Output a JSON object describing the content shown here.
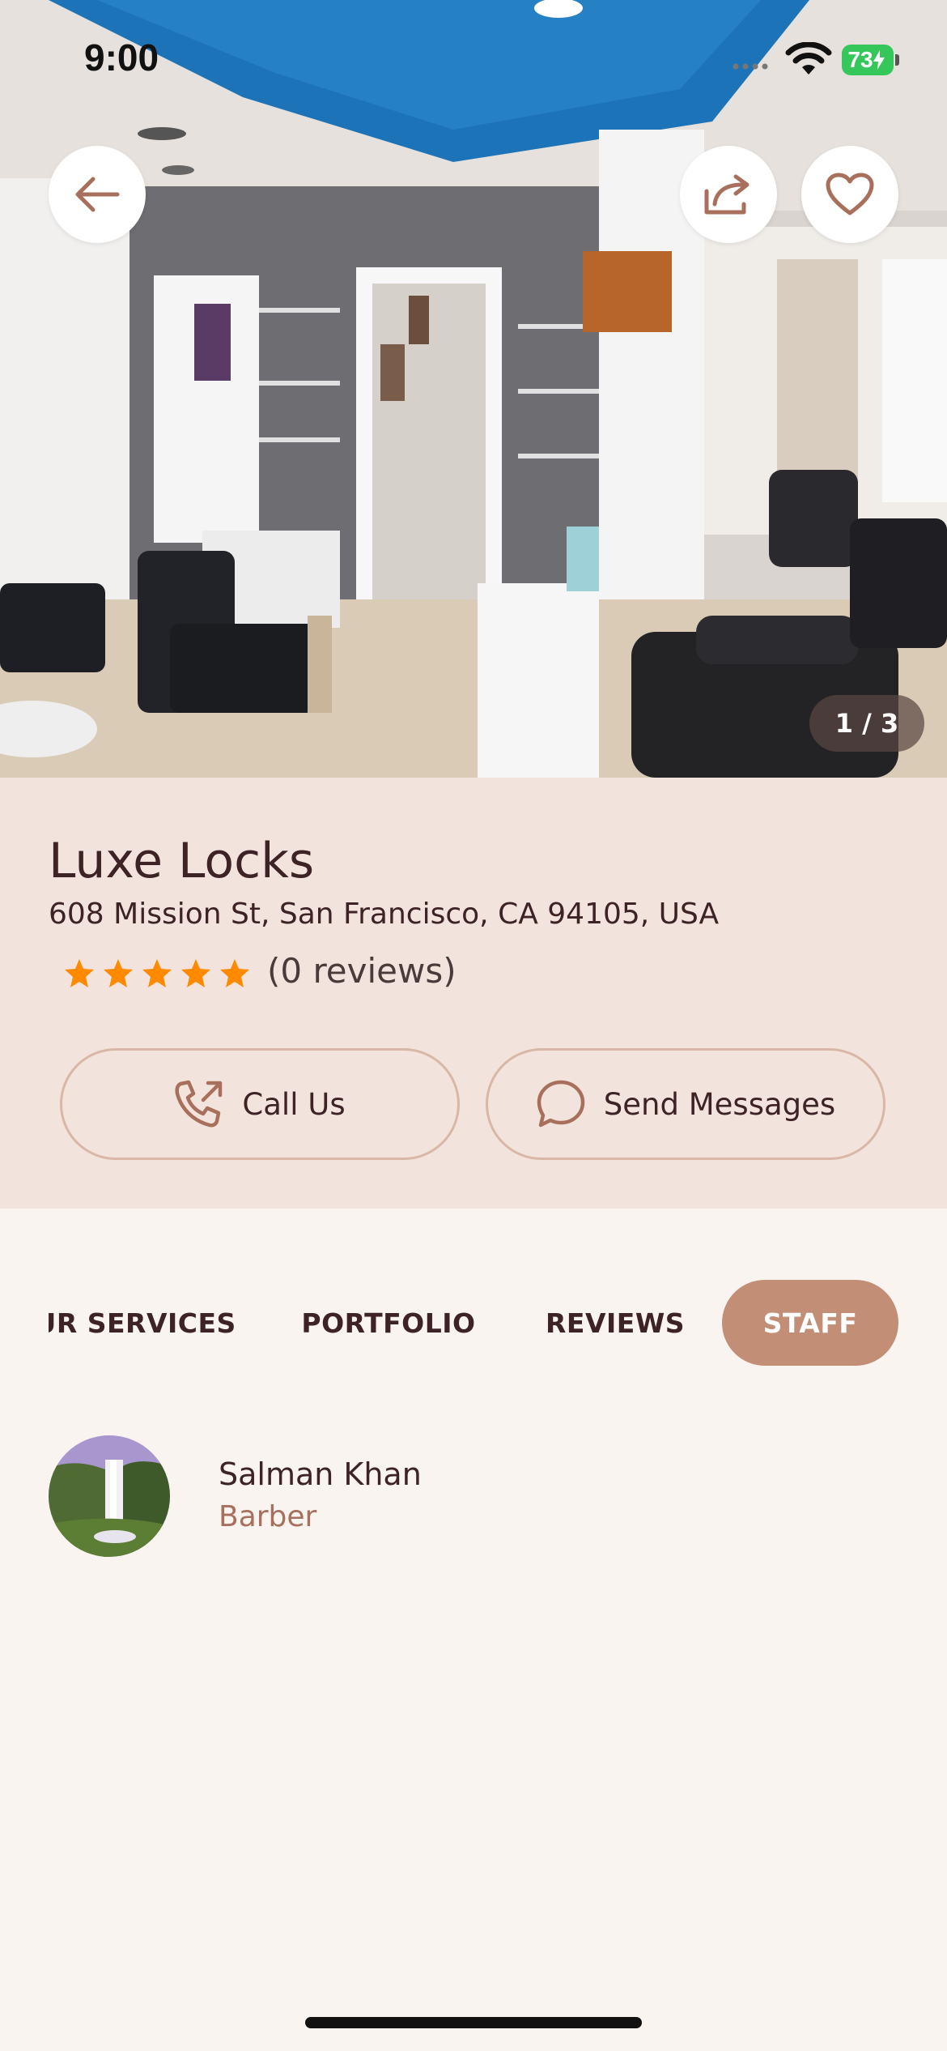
{
  "status_bar": {
    "time": "9:00",
    "battery": "73"
  },
  "hero": {
    "image_counter": "1 / 3"
  },
  "salon": {
    "name": "Luxe Locks",
    "address": "608 Mission St, San Francisco, CA 94105, USA",
    "rating": 5,
    "reviews_label": "(0 reviews)"
  },
  "actions": {
    "call_label": "Call Us",
    "message_label": "Send Messages"
  },
  "tabs": [
    {
      "label": "OUR SERVICES",
      "active": false
    },
    {
      "label": "PORTFOLIO",
      "active": false
    },
    {
      "label": "REVIEWS",
      "active": false
    },
    {
      "label": "STAFF",
      "active": true
    }
  ],
  "staff": [
    {
      "name": "Salman Khan",
      "role": "Barber"
    }
  ],
  "colors": {
    "accent": "#c38e76",
    "info_bg": "#f2e4dc",
    "page_bg": "#faf4f1",
    "text": "#3d2226",
    "star": "#ff8a00",
    "role_text": "#a8705c"
  },
  "icons": {
    "back": "arrow-left-icon",
    "share": "share-icon",
    "favorite": "heart-icon",
    "call": "phone-icon",
    "message": "chat-bubble-icon",
    "star": "star-icon"
  }
}
